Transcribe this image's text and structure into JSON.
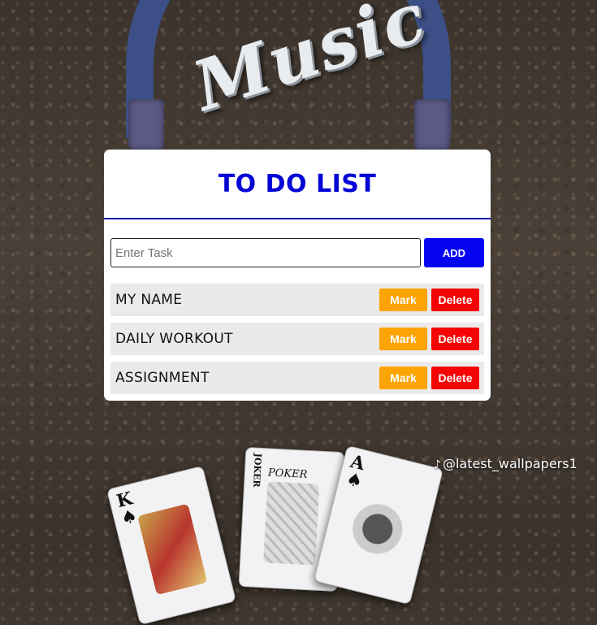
{
  "background": {
    "logo_text": "Music",
    "watermark_icon": "tiktok-icon",
    "watermark": "@latest_wallpapers1",
    "cards": [
      {
        "rank": "K",
        "suit": "♠"
      },
      {
        "rank": "JOKER",
        "word": "POKER"
      },
      {
        "rank": "A",
        "suit": "♠"
      }
    ]
  },
  "app": {
    "title": "TO DO LIST",
    "input": {
      "value": "",
      "placeholder": "Enter Task"
    },
    "add_label": "ADD",
    "tasks": [
      {
        "text": "MY NAME",
        "mark_label": "Mark",
        "delete_label": "Delete"
      },
      {
        "text": "DAILY WORKOUT",
        "mark_label": "Mark",
        "delete_label": "Delete"
      },
      {
        "text": "ASSIGNMENT",
        "mark_label": "Mark",
        "delete_label": "Delete"
      }
    ]
  },
  "colors": {
    "title": "#0505d6",
    "add_button": "#0404f2",
    "mark_button": "#fca404",
    "delete_button": "#f40404",
    "item_background": "#ece9ea"
  }
}
